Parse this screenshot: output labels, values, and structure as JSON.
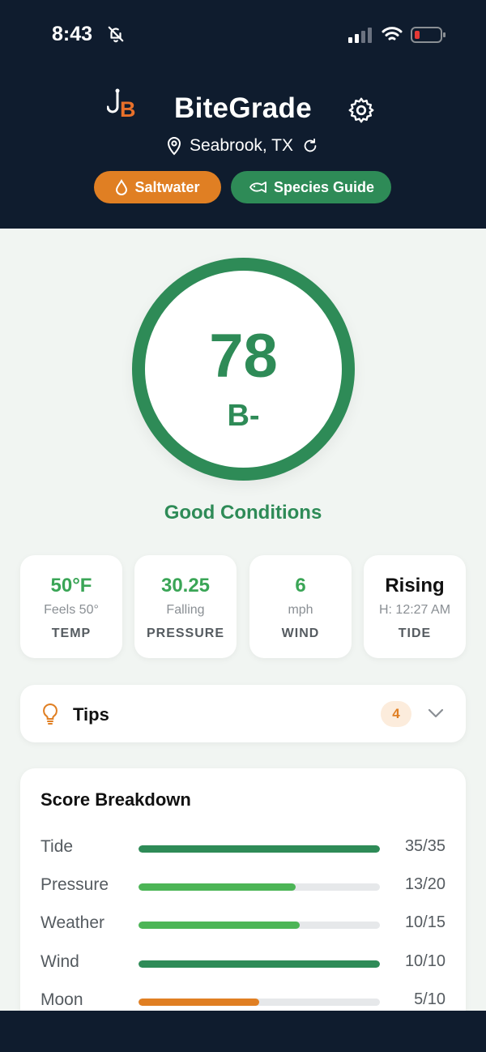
{
  "status_bar": {
    "time": "8:43"
  },
  "header": {
    "app_name": "BiteGrade",
    "location": "Seabrook, TX",
    "buttons": {
      "saltwater": "Saltwater",
      "species_guide": "Species Guide"
    }
  },
  "score": {
    "value": "78",
    "grade": "B-",
    "condition": "Good Conditions",
    "ring_color": "#2e8b57"
  },
  "stats": [
    {
      "value": "50°F",
      "sub": "Feels 50°",
      "label": "TEMP"
    },
    {
      "value": "30.25",
      "sub": "Falling",
      "label": "PRESSURE"
    },
    {
      "value": "6",
      "sub": "mph",
      "label": "WIND"
    },
    {
      "value": "Rising",
      "sub": "H: 12:27 AM",
      "label": "TIDE"
    }
  ],
  "tips": {
    "title": "Tips",
    "count": "4"
  },
  "breakdown": {
    "title": "Score Breakdown",
    "rows": [
      {
        "name": "Tide",
        "score": "35/35",
        "fraction": 1.0,
        "color": "#2e8b57"
      },
      {
        "name": "Pressure",
        "score": "13/20",
        "fraction": 0.65,
        "color": "#4cb556"
      },
      {
        "name": "Weather",
        "score": "10/15",
        "fraction": 0.667,
        "color": "#4cb556"
      },
      {
        "name": "Wind",
        "score": "10/10",
        "fraction": 1.0,
        "color": "#2e8b57"
      },
      {
        "name": "Moon",
        "score": "5/10",
        "fraction": 0.5,
        "color": "#e07f23"
      }
    ]
  },
  "colors": {
    "header_bg": "#0f1c2e",
    "accent_green": "#2e8b57",
    "accent_orange": "#e07f23"
  }
}
